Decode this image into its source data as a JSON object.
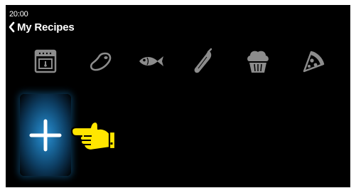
{
  "status": {
    "time": "20:00"
  },
  "header": {
    "back_label": "My Recipes",
    "back_icon": "chevron-left-icon"
  },
  "categories": [
    {
      "name": "oven",
      "icon": "oven-icon"
    },
    {
      "name": "meat",
      "icon": "meat-icon"
    },
    {
      "name": "fish",
      "icon": "fish-icon"
    },
    {
      "name": "vegetable",
      "icon": "zucchini-icon"
    },
    {
      "name": "dessert",
      "icon": "muffin-icon"
    },
    {
      "name": "pizza",
      "icon": "pizza-icon"
    }
  ],
  "add_button": {
    "icon": "plus-icon"
  },
  "hint": {
    "icon": "pointing-hand-icon"
  },
  "colors": {
    "background": "#000000",
    "text": "#ffffff",
    "icon_inactive": "#8c8c8c",
    "accent": "#1a6aa0",
    "hand": "#ffe600"
  }
}
